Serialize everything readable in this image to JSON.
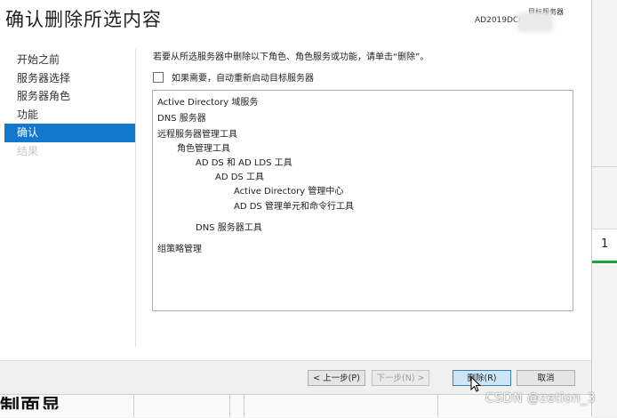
{
  "window": {
    "title": "确认删除所选内容",
    "destination_label": "目标服务器",
    "destination_server": "AD2019DC0 .COM"
  },
  "nav": {
    "items": [
      {
        "label": "开始之前",
        "state": "normal"
      },
      {
        "label": "服务器选择",
        "state": "normal"
      },
      {
        "label": "服务器角色",
        "state": "normal"
      },
      {
        "label": "功能",
        "state": "normal"
      },
      {
        "label": "确认",
        "state": "active"
      },
      {
        "label": "结果",
        "state": "disabled"
      }
    ]
  },
  "content": {
    "instruction": "若要从所选服务器中删除以下角色、角色服务或功能，请单击“删除”。",
    "restart_checkbox": {
      "label": "如果需要，自动重新启动目标服务器",
      "checked": false
    },
    "items": [
      {
        "text": "Active Directory 域服务",
        "level": 0
      },
      {
        "text": "DNS 服务器",
        "level": 0
      },
      {
        "text": "远程服务器管理工具",
        "level": 0
      },
      {
        "text": "角色管理工具",
        "level": 1
      },
      {
        "text": "AD DS 和 AD LDS 工具",
        "level": 2
      },
      {
        "text": "AD DS 工具",
        "level": 3
      },
      {
        "text": "Active Directory 管理中心",
        "level": 4
      },
      {
        "text": "AD DS 管理单元和命令行工具",
        "level": 4
      },
      {
        "text": "DNS 服务器工具",
        "level": 2
      },
      {
        "text": "组策略管理",
        "level": 0
      }
    ]
  },
  "buttons": {
    "previous": "< 上一步(P)",
    "next": "下一步(N) >",
    "remove": "删除(R)",
    "cancel": "取消"
  },
  "background": {
    "right_panel_number": "1",
    "bottom_partial_text": "制面显"
  },
  "watermark": "CSDN @zetion_3",
  "colors": {
    "accent": "#1478cc",
    "primary_button": "#cde6f7",
    "status_green": "#19a339"
  }
}
